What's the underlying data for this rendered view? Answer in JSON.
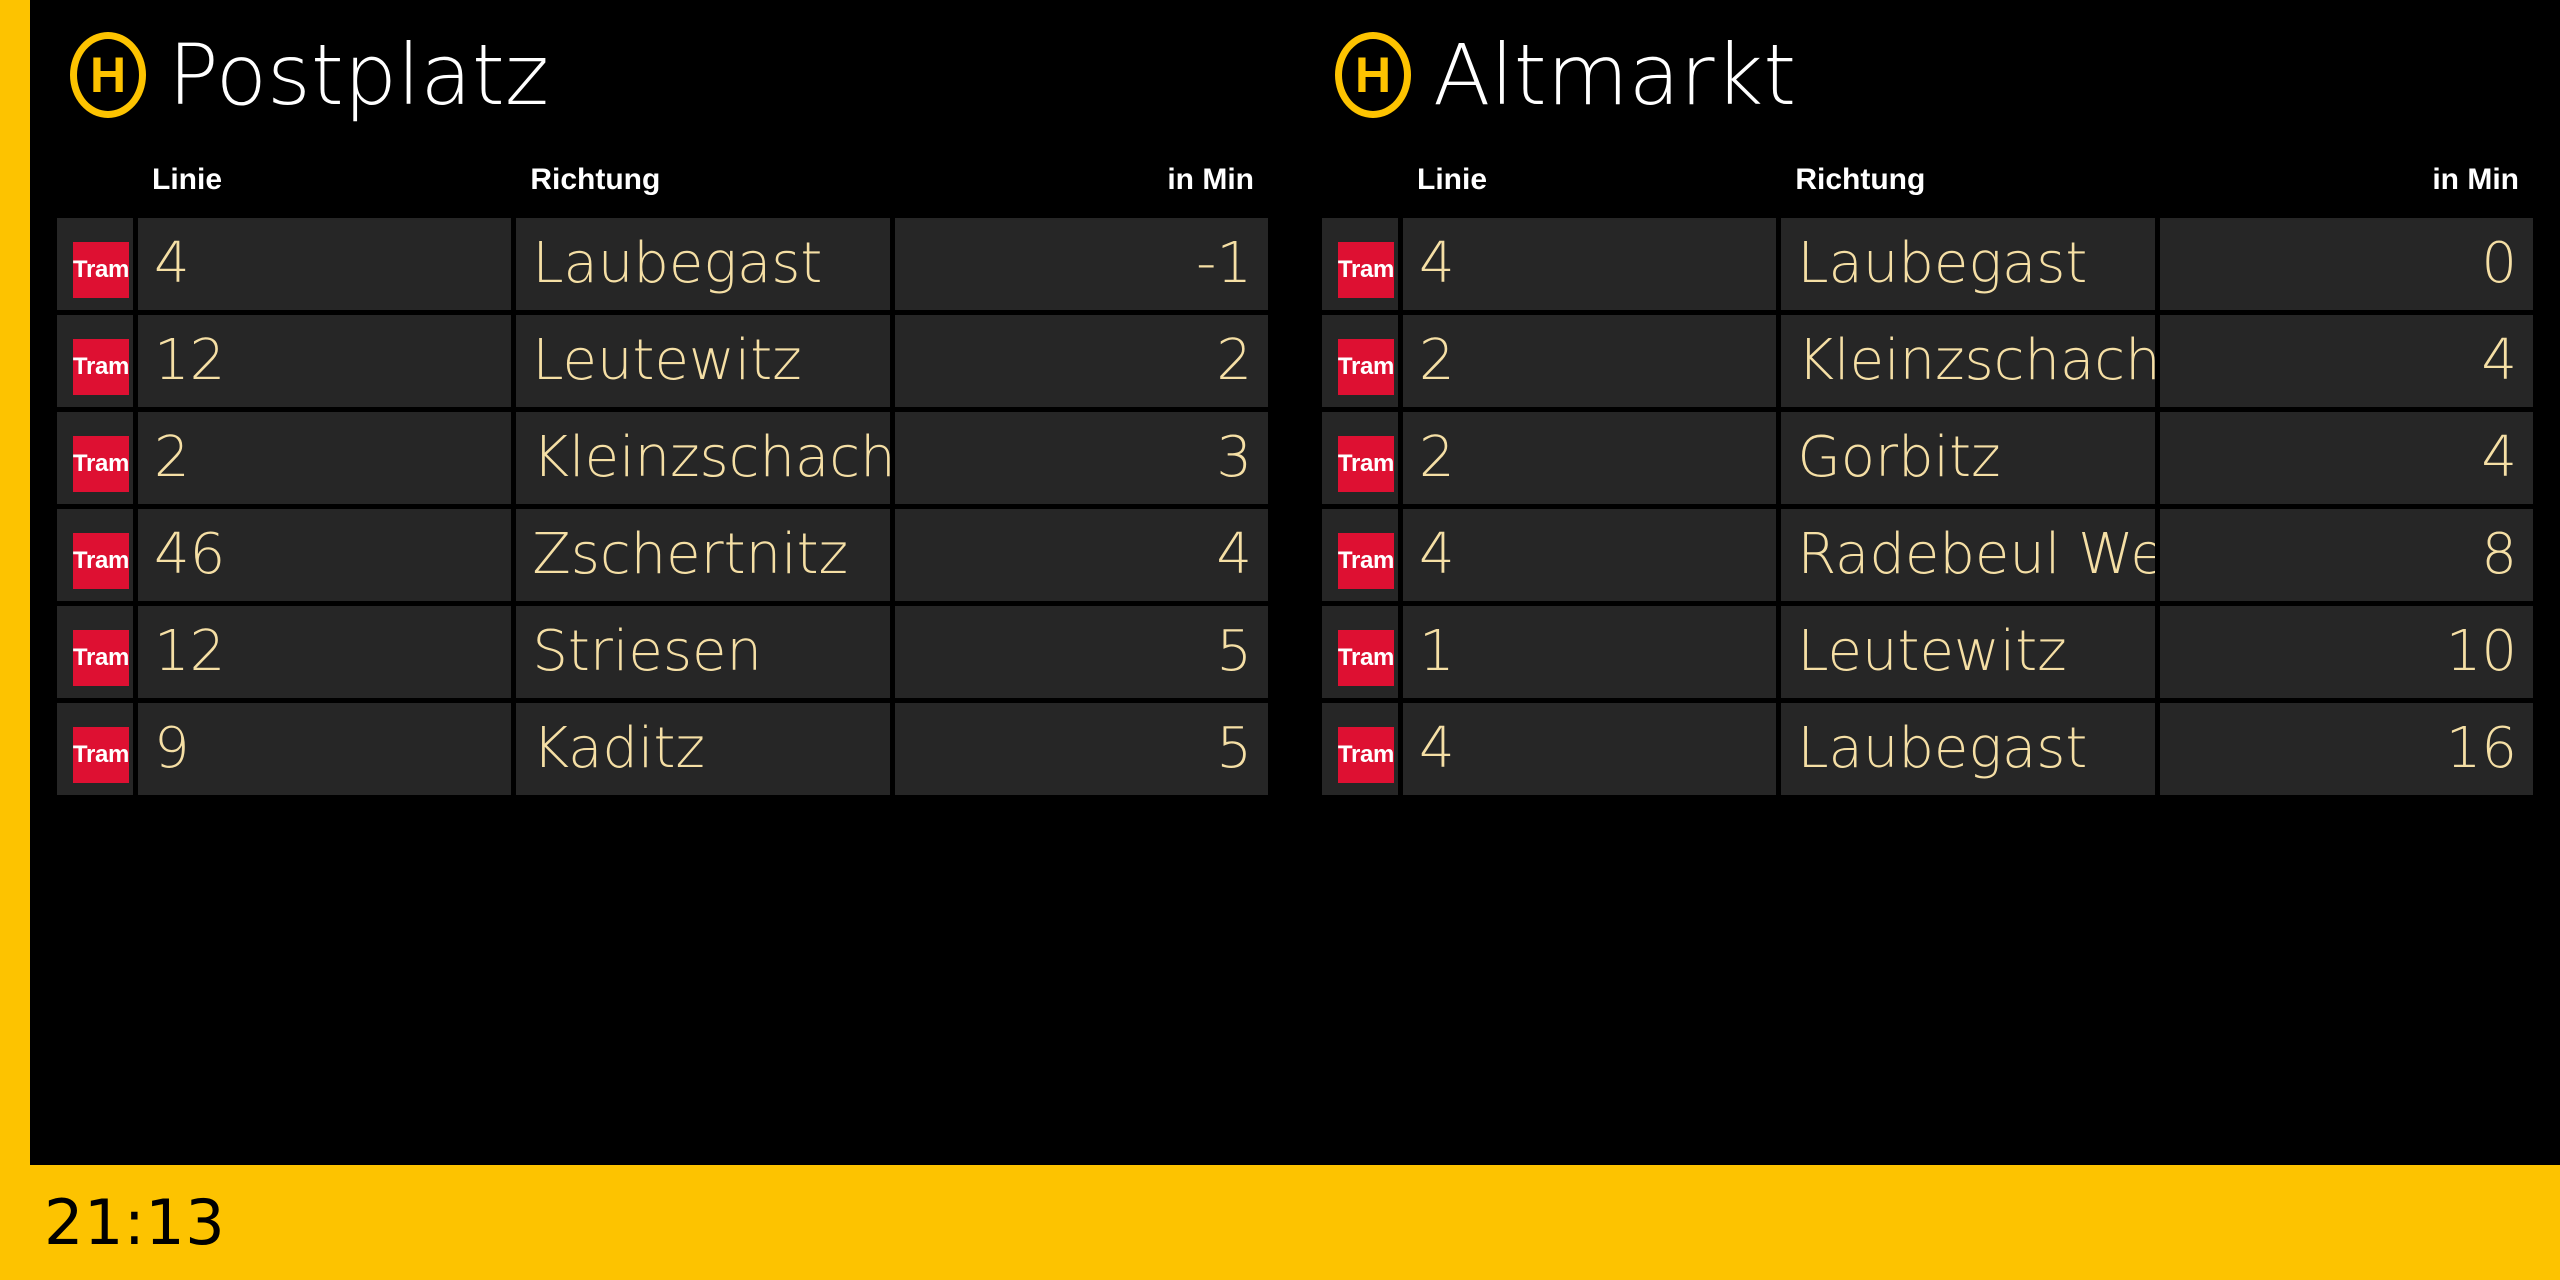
{
  "colors": {
    "accent_yellow": "#FDC300",
    "background": "#000000",
    "cell_background": "#262626",
    "value_text": "#F5DFA5",
    "header_text": "#FFFFFF",
    "tram_badge_red": "#DE1032"
  },
  "columns": {
    "line": "Linie",
    "direction": "Richtung",
    "minutes": "in Min"
  },
  "stop_symbol": "H",
  "panels": [
    {
      "station": "Postplatz",
      "departures": [
        {
          "mode": "Tram",
          "line": "4",
          "direction": "Laubegast",
          "minutes": "-1"
        },
        {
          "mode": "Tram",
          "line": "12",
          "direction": "Leutewitz",
          "minutes": "2"
        },
        {
          "mode": "Tram",
          "line": "2",
          "direction": "Kleinzschachwitz",
          "minutes": "3"
        },
        {
          "mode": "Tram",
          "line": "46",
          "direction": "Zschertnitz",
          "minutes": "4"
        },
        {
          "mode": "Tram",
          "line": "12",
          "direction": "Striesen",
          "minutes": "5"
        },
        {
          "mode": "Tram",
          "line": "9",
          "direction": "Kaditz",
          "minutes": "5"
        }
      ]
    },
    {
      "station": "Altmarkt",
      "departures": [
        {
          "mode": "Tram",
          "line": "4",
          "direction": "Laubegast",
          "minutes": "0"
        },
        {
          "mode": "Tram",
          "line": "2",
          "direction": "Kleinzschachwitz",
          "minutes": "4"
        },
        {
          "mode": "Tram",
          "line": "2",
          "direction": "Gorbitz",
          "minutes": "4"
        },
        {
          "mode": "Tram",
          "line": "4",
          "direction": "Radebeul West",
          "minutes": "8"
        },
        {
          "mode": "Tram",
          "line": "1",
          "direction": "Leutewitz",
          "minutes": "10"
        },
        {
          "mode": "Tram",
          "line": "4",
          "direction": "Laubegast",
          "minutes": "16"
        }
      ]
    }
  ],
  "footer": {
    "time": "21:13"
  }
}
